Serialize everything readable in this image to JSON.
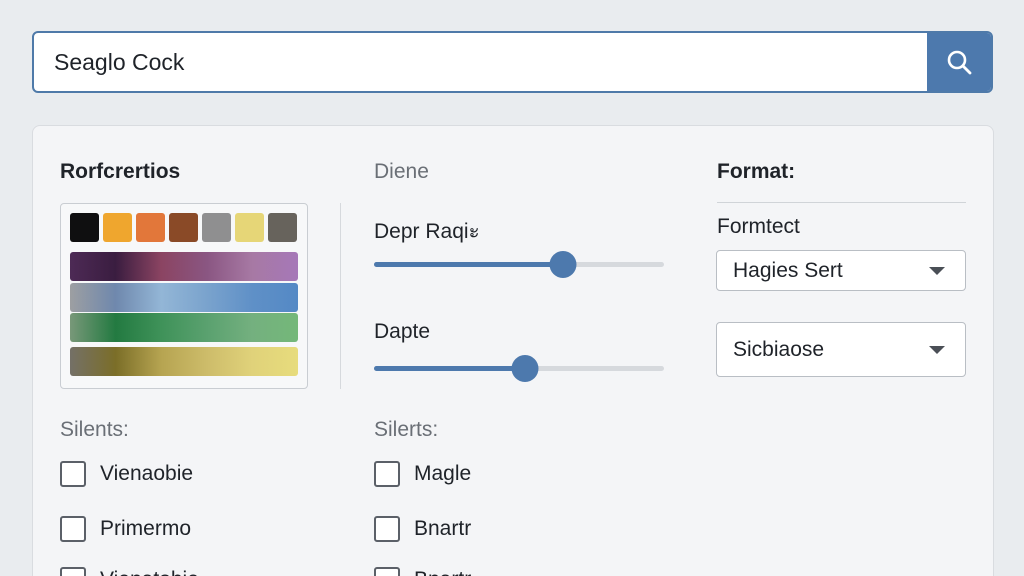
{
  "search": {
    "value": "Seaglo Cock",
    "icon": "search-icon"
  },
  "column1": {
    "heading": "Rorfcrertios",
    "section_label": "Silents:",
    "checkboxes": [
      "Vienaobie",
      "Primermo",
      "Vienatohie"
    ]
  },
  "column2": {
    "heading": "Diene",
    "slider1": {
      "label": "Depr Raqiะ",
      "value": 0.65
    },
    "slider2": {
      "label": "Dapte",
      "value": 0.52
    },
    "section_label": "Silerts:",
    "checkboxes": [
      "Magle",
      "Bnartr",
      "Bnartr"
    ]
  },
  "column3": {
    "heading": "Format:",
    "subheading": "Formtect",
    "select1": "Hagies Sert",
    "select2": "Sicbiaose"
  },
  "colors": {
    "accent": "#4d79ad",
    "palette_row1": [
      "#0f0f10",
      "#efa62e",
      "#e2773a",
      "#8a4a27",
      "#8f8f90",
      "#e6d677",
      "#67635c"
    ],
    "palette_row2": [
      "#4d2a55",
      "#3a1d40",
      "#8b4462",
      "#8a5682",
      "#a779a4",
      "#a678b8"
    ],
    "palette_row3": [
      "#9d9fa2",
      "#6f88ad",
      "#93b6d6",
      "#7aa3cd",
      "#5f90c7",
      "#5489c5"
    ],
    "palette_row4": [
      "#789879",
      "#237a41",
      "#3f9259",
      "#5aa16f",
      "#74b07f",
      "#74b879"
    ],
    "palette_row5": [
      "#747067",
      "#7b6e28",
      "#b6a451",
      "#cdbc6a",
      "#e0d27a",
      "#e7dc7c"
    ]
  }
}
